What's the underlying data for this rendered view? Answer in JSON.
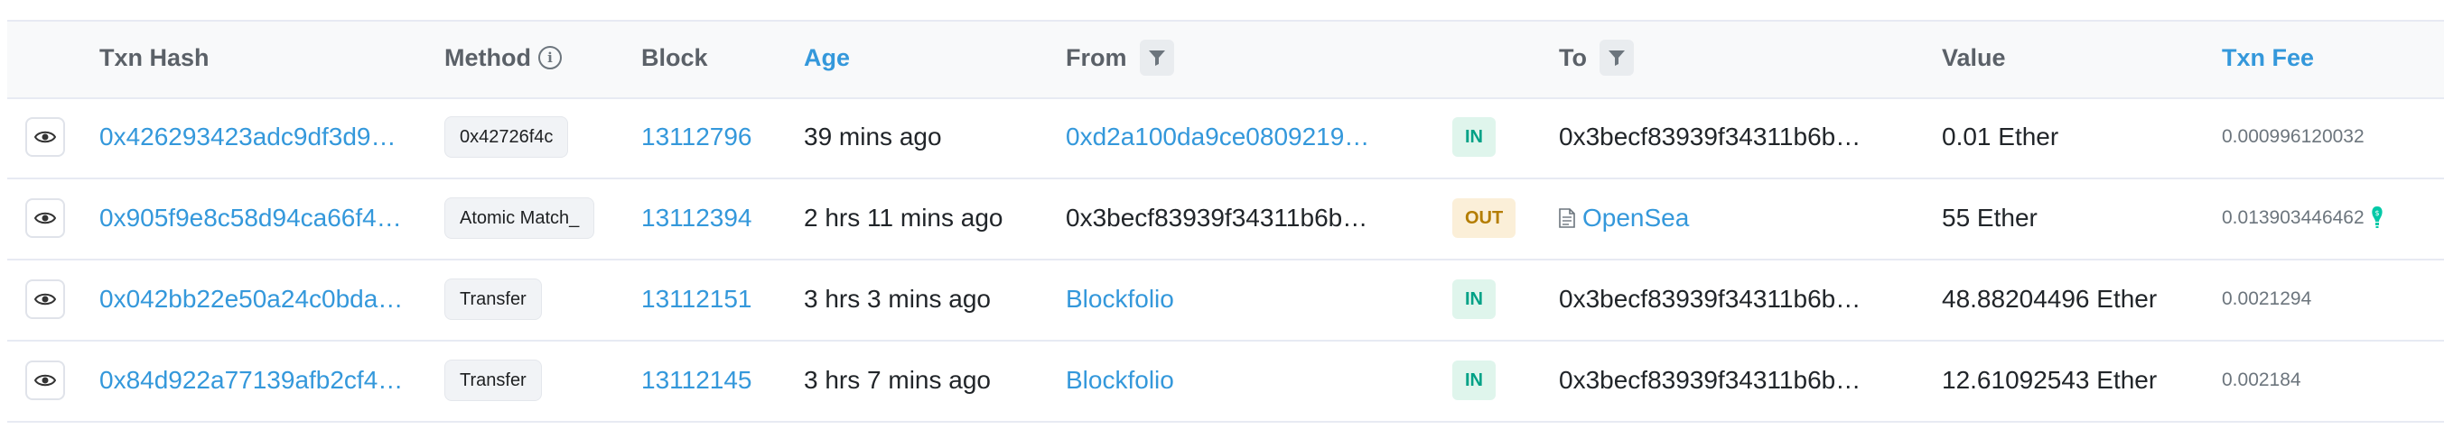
{
  "columns": {
    "txn_hash": "Txn Hash",
    "method": "Method",
    "block": "Block",
    "age": "Age",
    "from": "From",
    "to": "To",
    "value": "Value",
    "txn_fee": "Txn Fee"
  },
  "colors": {
    "link": "#3498db",
    "in_bg": "#dff5ec",
    "in_text": "#00a186",
    "out_bg": "#fbefd8",
    "out_text": "#b47d00",
    "gas_icon": "#00c9a7"
  },
  "rows": [
    {
      "hash": "0x426293423adc9df3d9…",
      "method": "0x42726f4c",
      "block": "13112796",
      "age": "39 mins ago",
      "from": "0xd2a100da9ce0809219…",
      "direction": "IN",
      "to": "0x3becf83939f34311b6b…",
      "value": "0.01 Ether",
      "fee": "0.000996120032"
    },
    {
      "hash": "0x905f9e8c58d94ca66f4…",
      "method": "Atomic Match_",
      "block": "13112394",
      "age": "2 hrs 11 mins ago",
      "from": "0x3becf83939f34311b6b…",
      "direction": "OUT",
      "to_icon": "contract-icon",
      "to": "OpenSea",
      "value": "55 Ether",
      "fee": "0.013903446462"
    },
    {
      "hash": "0x042bb22e50a24c0bda…",
      "method": "Transfer",
      "block": "13112151",
      "age": "3 hrs 3 mins ago",
      "from": "Blockfolio",
      "direction": "IN",
      "to": "0x3becf83939f34311b6b…",
      "value": "48.88204496 Ether",
      "fee": "0.0021294"
    },
    {
      "hash": "0x84d922a77139afb2cf4…",
      "method": "Transfer",
      "block": "13112145",
      "age": "3 hrs 7 mins ago",
      "from": "Blockfolio",
      "direction": "IN",
      "to": "0x3becf83939f34311b6b…",
      "value": "12.61092543 Ether",
      "fee": "0.002184"
    }
  ]
}
